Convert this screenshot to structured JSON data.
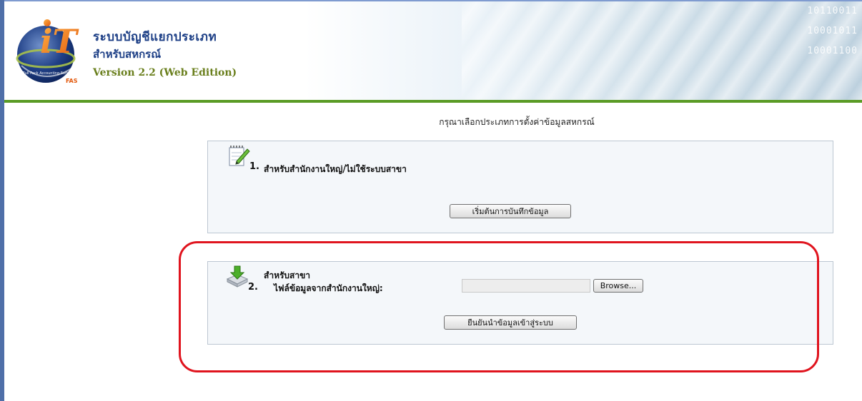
{
  "header": {
    "title_line1": "ระบบบัญชีแยกประเภท",
    "title_line2": "สำหรับสหกรณ์",
    "version": "Version 2.2 (Web Edition)",
    "logo_text": "iT",
    "logo_ring_text": "Full Pack Accounting Software",
    "logo_badge": "FAS",
    "binary_lines": [
      "10110011",
      "10001011",
      "10001100"
    ]
  },
  "instruction": "กรุณาเลือกประเภทการตั้งค่าข้อมูลสหกรณ์",
  "option1": {
    "number": "1.",
    "label": "สำหรับสำนักงานใหญ่/ไม่ใช้ระบบสาขา",
    "button": "เริ่มต้นการบันทึกข้อมูล",
    "icon": "notepad-pencil-icon"
  },
  "option2": {
    "number": "2.",
    "label_line1": "สำหรับสาขา",
    "label_line2": "ไฟล์ข้อมูลจากสำนักงานใหญ่:",
    "file_value": "",
    "browse_button": "Browse...",
    "confirm_button": "ยืนยันนำข้อมูลเข้าสู่ระบบ",
    "icon": "download-tray-icon"
  },
  "colors": {
    "accent_green": "#5a9b25",
    "title_blue": "#1d3f86",
    "highlight_red": "#e0141e"
  }
}
